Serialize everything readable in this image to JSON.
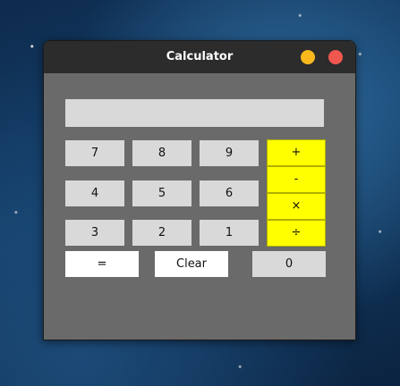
{
  "window": {
    "title": "Calculator",
    "colors": {
      "titlebar": "#2c2c2c",
      "body": "#6a6a6a",
      "minimize": "#f9b91c",
      "close": "#f0584f"
    }
  },
  "display": {
    "value": ""
  },
  "keys": {
    "seven": "7",
    "eight": "8",
    "nine": "9",
    "four": "4",
    "five": "5",
    "six": "6",
    "three": "3",
    "two": "2",
    "one": "1",
    "zero": "0",
    "plus": "+",
    "minus": "-",
    "multiply": "×",
    "divide": "÷",
    "equals": "=",
    "clear": "Clear"
  },
  "colors": {
    "digit_key": "#d9d9d9",
    "operator_key": "#ffff00",
    "action_key": "#ffffff"
  }
}
